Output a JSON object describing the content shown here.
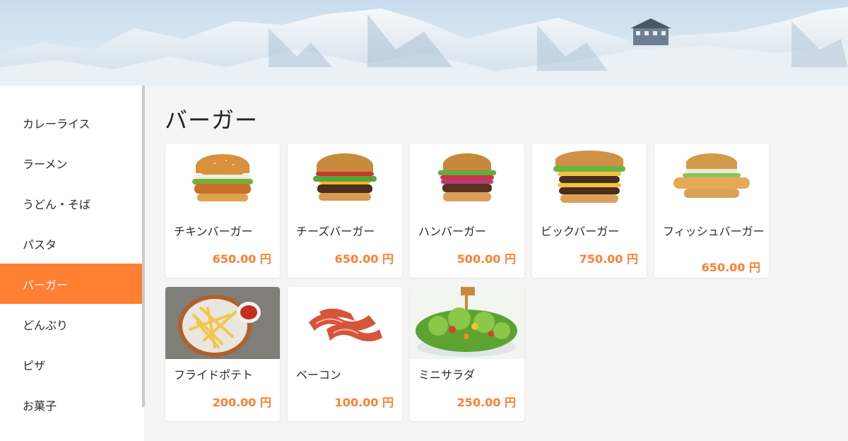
{
  "sidebar": {
    "items": [
      {
        "label": "カレーライス",
        "active": false
      },
      {
        "label": "ラーメン",
        "active": false
      },
      {
        "label": "うどん・そば",
        "active": false
      },
      {
        "label": "パスタ",
        "active": false
      },
      {
        "label": "バーガー",
        "active": true
      },
      {
        "label": "どんぶり",
        "active": false
      },
      {
        "label": "ピザ",
        "active": false
      },
      {
        "label": "お菓子",
        "active": false
      }
    ]
  },
  "main": {
    "title": "バーガー",
    "products": [
      {
        "name": "チキンバーガー",
        "price": "650.00 円",
        "icon": "chicken-burger-image"
      },
      {
        "name": "チーズバーガー",
        "price": "650.00 円",
        "icon": "cheeseburger-image"
      },
      {
        "name": "ハンバーガー",
        "price": "500.00 円",
        "icon": "hamburger-image"
      },
      {
        "name": "ビックバーガー",
        "price": "750.00 円",
        "icon": "big-burger-image"
      },
      {
        "name": "フィッシュバーガー",
        "price": "650.00 円",
        "icon": "fish-burger-image"
      },
      {
        "name": "フライドポテト",
        "price": "200.00 円",
        "icon": "french-fries-image"
      },
      {
        "name": "ベーコン",
        "price": "100.00 円",
        "icon": "bacon-image"
      },
      {
        "name": "ミニサラダ",
        "price": "250.00 円",
        "icon": "salad-image"
      }
    ]
  },
  "colors": {
    "accent": "#ff7f33",
    "sidebar_bg": "#ffffff",
    "main_bg": "#f5f5f5"
  }
}
